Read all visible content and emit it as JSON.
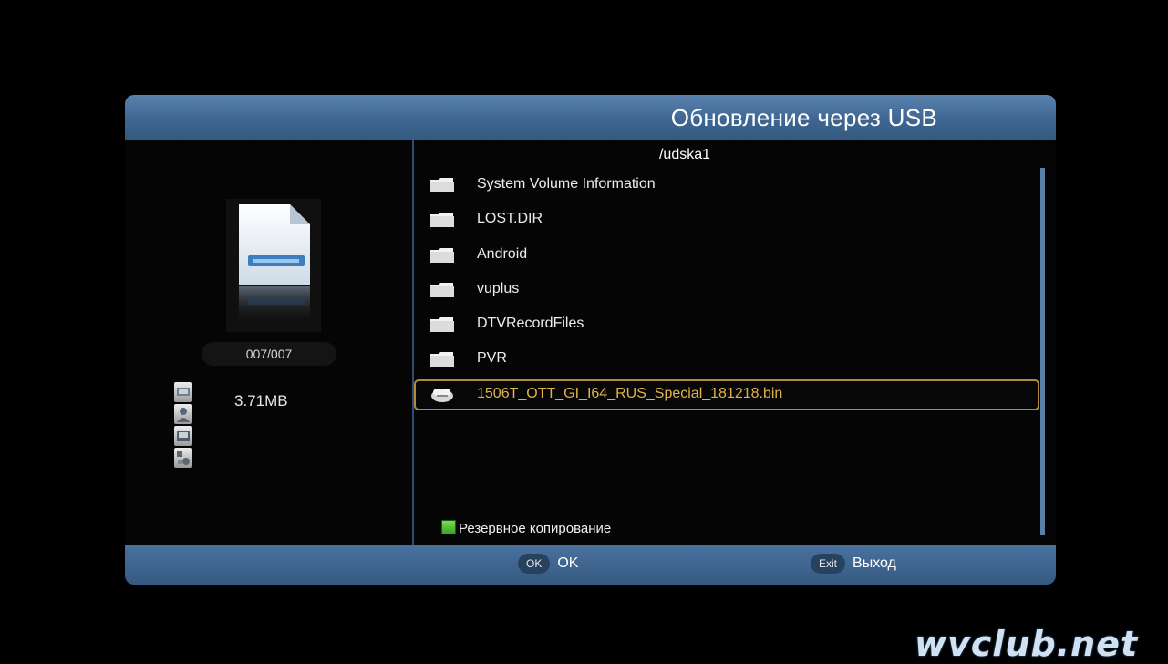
{
  "dialog": {
    "title": "Обновление через USB"
  },
  "left": {
    "counter": "007/007",
    "file_size": "3.71MB",
    "side_icons": [
      "settings-icon",
      "user-icon",
      "window-icon",
      "tools-icon"
    ]
  },
  "browser": {
    "path": "/udska1",
    "items": [
      {
        "name": "System Volume Information",
        "type": "folder"
      },
      {
        "name": "LOST.DIR",
        "type": "folder"
      },
      {
        "name": "Android",
        "type": "folder"
      },
      {
        "name": "vuplus",
        "type": "folder"
      },
      {
        "name": "DTVRecordFiles",
        "type": "folder"
      },
      {
        "name": "PVR",
        "type": "folder"
      },
      {
        "name": "1506T_OTT_GI_I64_RUS_Special_181218.bin",
        "type": "bin-file",
        "selected": true
      }
    ]
  },
  "actions": {
    "backup_label": "Резервное копирование"
  },
  "footer": {
    "ok_key": "OK",
    "ok_label": "OK",
    "exit_key": "Exit",
    "exit_label": "Выход"
  },
  "watermark": "wvclub.net",
  "colors": {
    "title_bar": "#3e6692",
    "selection_border": "#b18a3a",
    "selection_text": "#e2b24a",
    "backup_key": "#4fbf2e"
  }
}
